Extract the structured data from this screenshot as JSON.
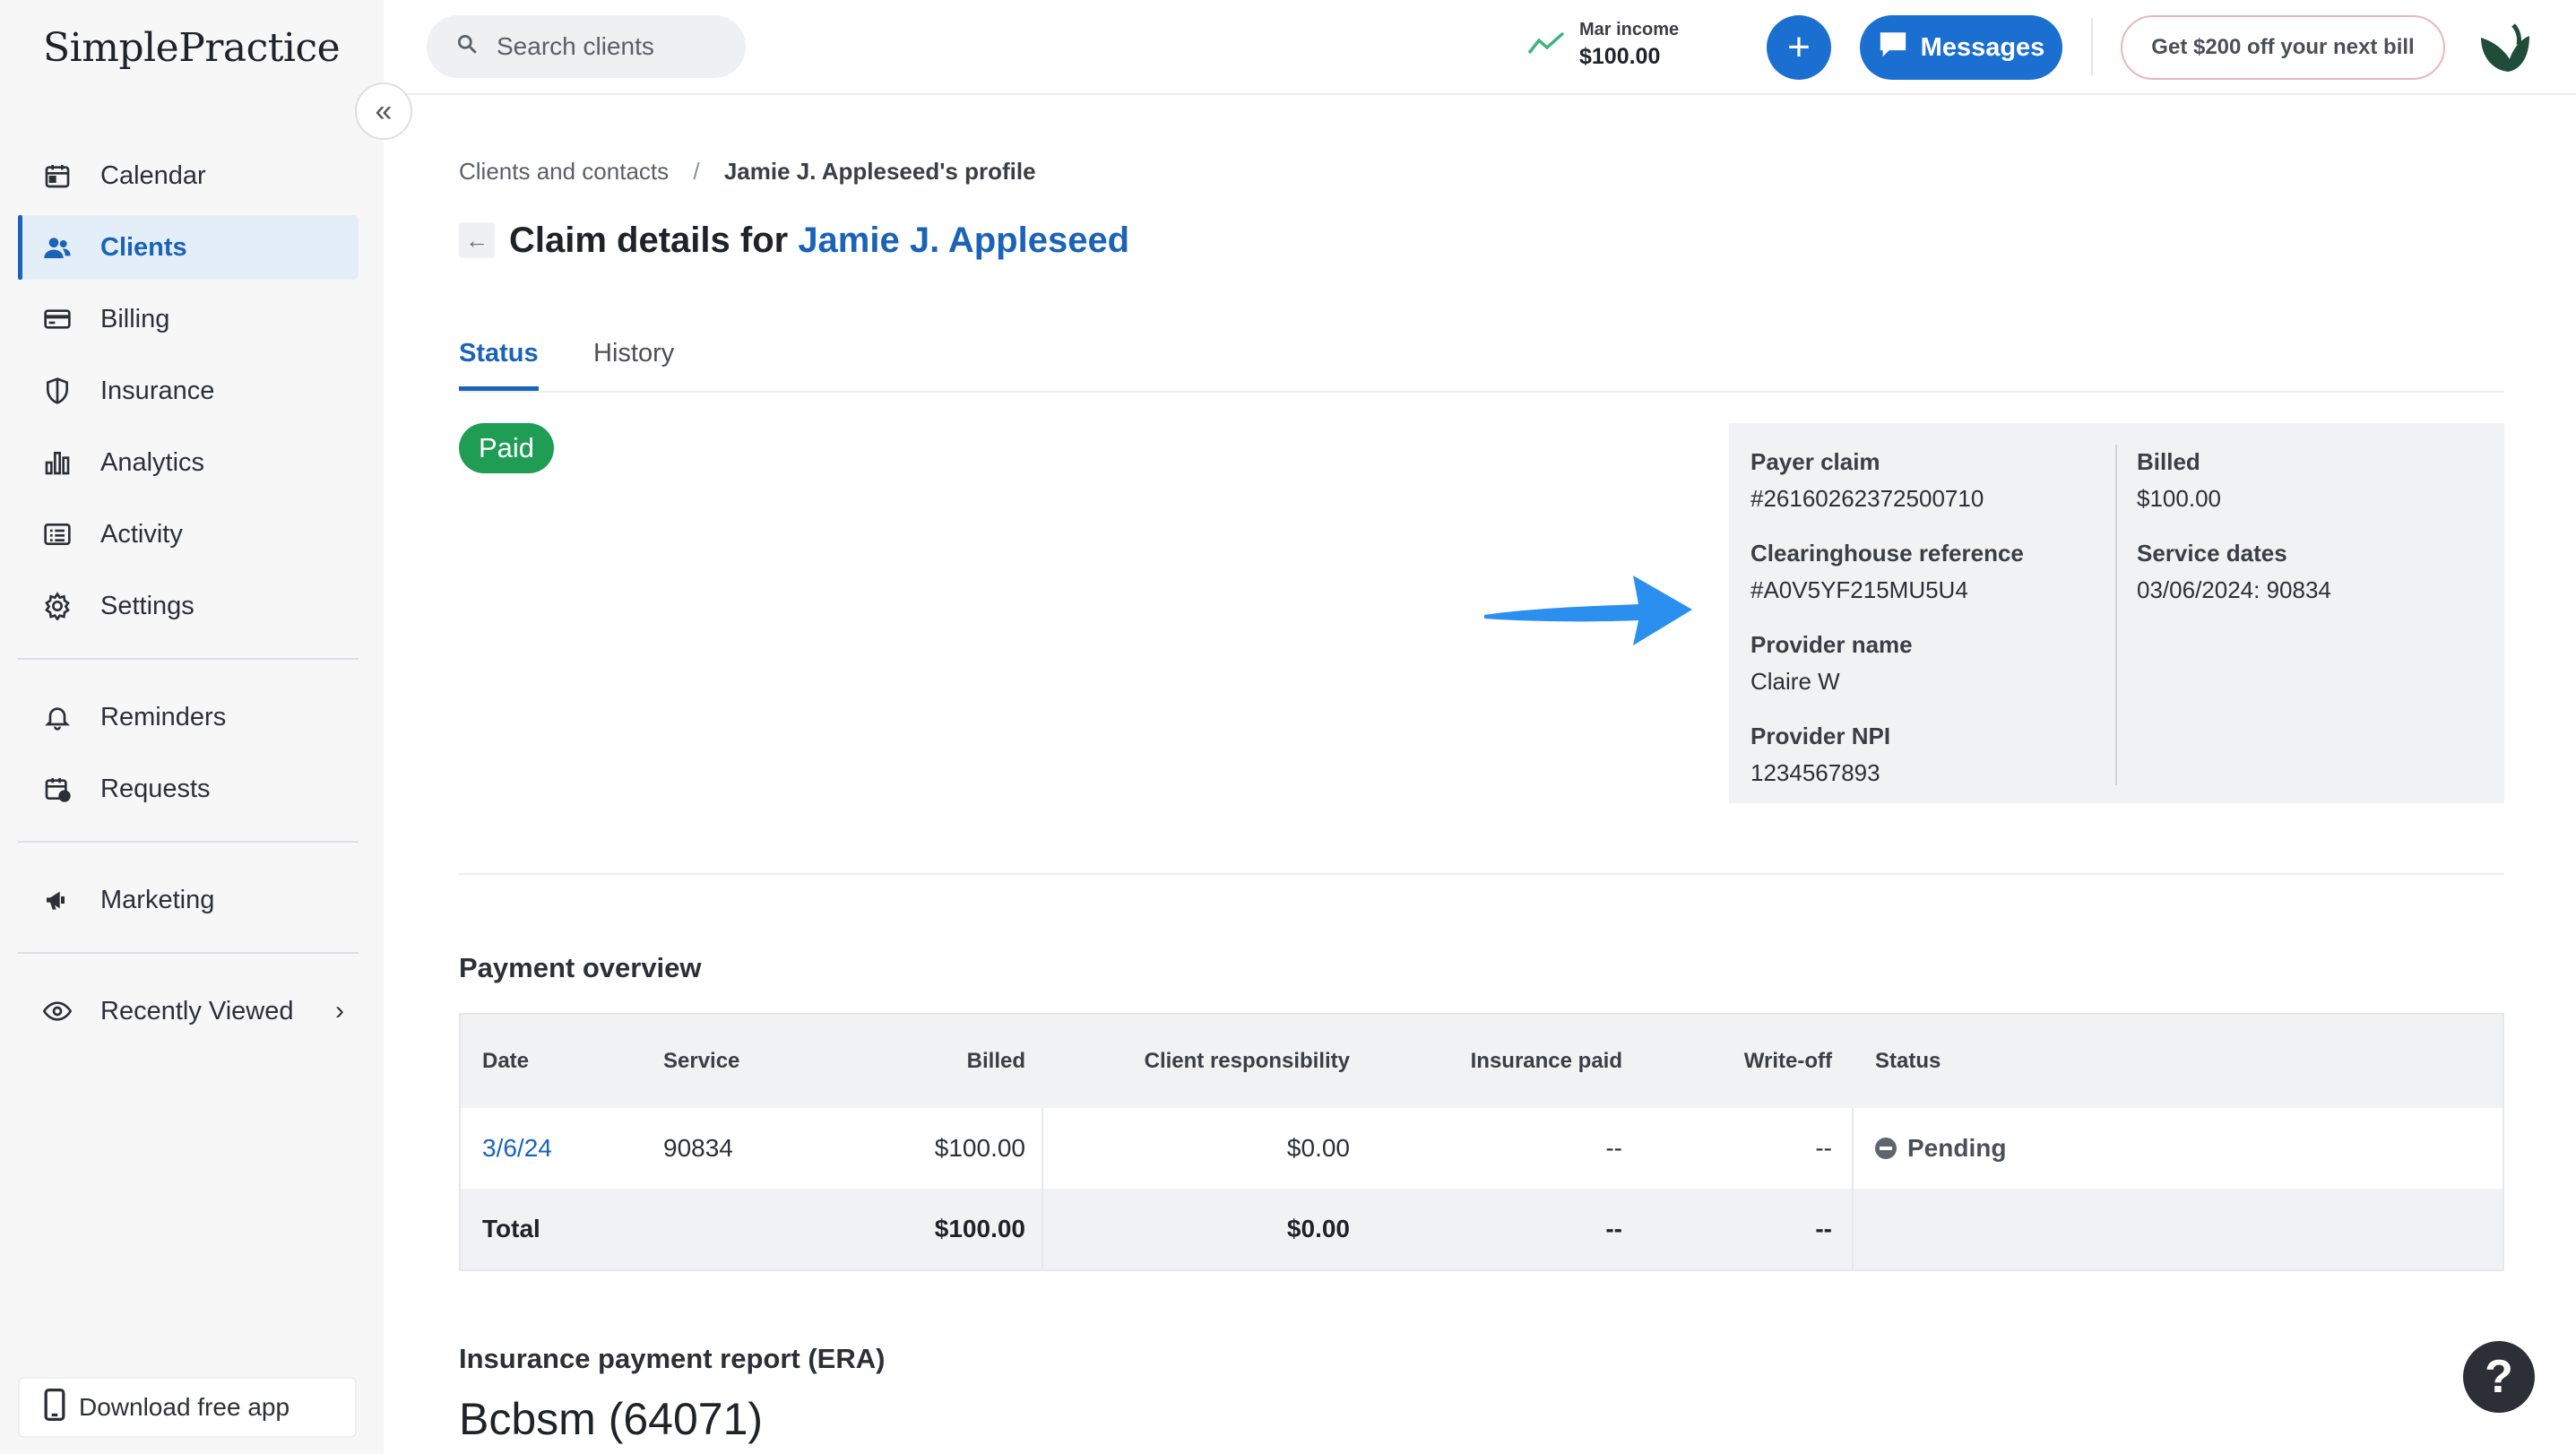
{
  "app": {
    "logo_text": "SimplePractice"
  },
  "sidebar": {
    "collapse_label": "«",
    "items": [
      {
        "label": "Calendar",
        "icon": "calendar-icon",
        "active": false
      },
      {
        "label": "Clients",
        "icon": "people-icon",
        "active": true
      },
      {
        "label": "Billing",
        "icon": "credit-card-icon",
        "active": false
      },
      {
        "label": "Insurance",
        "icon": "shield-icon",
        "active": false
      },
      {
        "label": "Analytics",
        "icon": "bar-chart-icon",
        "active": false
      },
      {
        "label": "Activity",
        "icon": "list-icon",
        "active": false
      },
      {
        "label": "Settings",
        "icon": "gear-icon",
        "active": false
      }
    ],
    "items2": [
      {
        "label": "Reminders",
        "icon": "bell-icon"
      },
      {
        "label": "Requests",
        "icon": "calendar-request-icon"
      }
    ],
    "items3": [
      {
        "label": "Marketing",
        "icon": "megaphone-icon"
      }
    ],
    "recently_viewed": {
      "label": "Recently Viewed",
      "icon": "eye-icon"
    },
    "download_app": {
      "label": "Download free app",
      "icon": "phone-icon"
    }
  },
  "topbar": {
    "search_placeholder": "Search clients",
    "income_label": "Mar income",
    "income_value": "$100.00",
    "plus_label": "+",
    "messages_label": "Messages",
    "promo_label": "Get $200 off your next bill"
  },
  "breadcrumb": {
    "parent": "Clients and contacts",
    "separator": "/",
    "current": "Jamie J. Appleseed's profile"
  },
  "page": {
    "title_prefix": "Claim details for ",
    "client_name": "Jamie J. Appleseed",
    "back_label": "←"
  },
  "tabs": [
    {
      "label": "Status",
      "active": true
    },
    {
      "label": "History",
      "active": false
    }
  ],
  "claim": {
    "status": "Paid",
    "left_fields": [
      {
        "label": "Payer claim",
        "value": "#26160262372500710"
      },
      {
        "label": "Clearinghouse reference",
        "value": "#A0V5YF215MU5U4"
      },
      {
        "label": "Provider name",
        "value": "Claire W"
      },
      {
        "label": "Provider NPI",
        "value": "1234567893"
      }
    ],
    "right_fields": [
      {
        "label": "Billed",
        "value": "$100.00"
      },
      {
        "label": "Service dates",
        "value": "03/06/2024: 90834"
      }
    ]
  },
  "payment_overview": {
    "title": "Payment overview",
    "headers": {
      "date": "Date",
      "service": "Service",
      "billed": "Billed",
      "client": "Client responsibility",
      "insurance": "Insurance paid",
      "writeoff": "Write-off",
      "status": "Status"
    },
    "rows": [
      {
        "date": "3/6/24",
        "service": "90834",
        "billed": "$100.00",
        "client": "$0.00",
        "insurance": "--",
        "writeoff": "--",
        "status": "Pending"
      }
    ],
    "total": {
      "label": "Total",
      "billed": "$100.00",
      "client": "$0.00",
      "insurance": "--",
      "writeoff": "--"
    }
  },
  "era": {
    "title": "Insurance payment report (ERA)",
    "payer": "Bcbsm (64071)"
  },
  "help": {
    "label": "?"
  },
  "colors": {
    "accent": "#1b6fd1",
    "link": "#1a63b8",
    "paid": "#1f9d55",
    "arrow": "#2b8ff0"
  }
}
